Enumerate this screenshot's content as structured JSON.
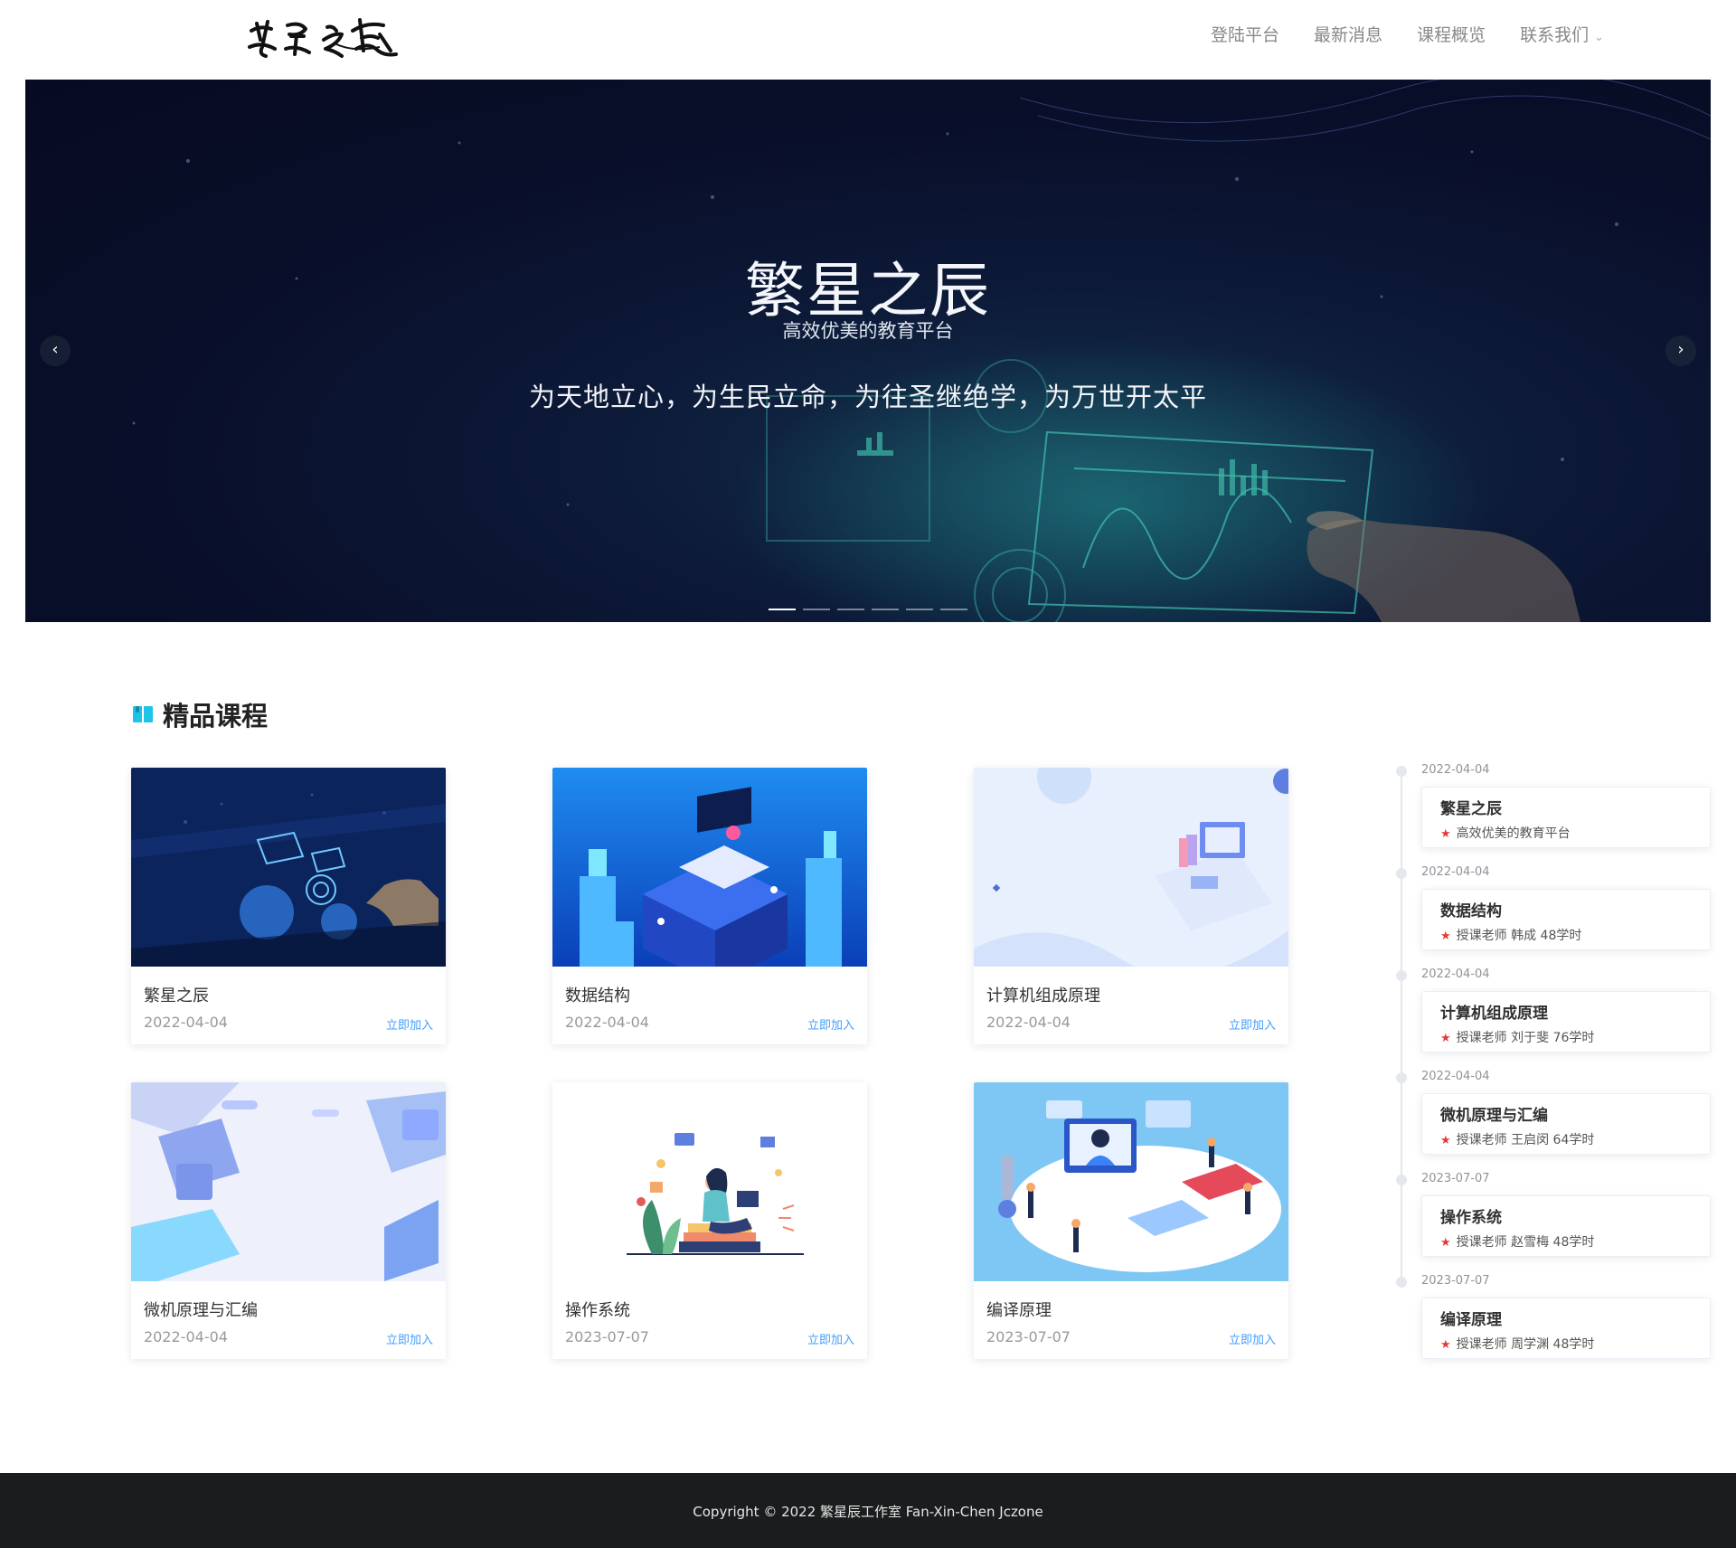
{
  "header": {
    "logo_text": "繁星之辰",
    "nav": [
      {
        "label": "登陆平台"
      },
      {
        "label": "最新消息"
      },
      {
        "label": "课程概览"
      },
      {
        "label": "联系我们",
        "has_dropdown": true
      }
    ]
  },
  "banner": {
    "title": "繁星之辰",
    "subtitle": "高效优美的教育平台",
    "motto": "为天地立心，为生民立命，为往圣继绝学，为万世开太平",
    "prev_icon": "‹",
    "next_icon": "›",
    "slide_count": 6,
    "active_slide": 0
  },
  "section": {
    "title": "精品课程",
    "icon": "book-icon",
    "accent_color": "#1ec4e6"
  },
  "courses": [
    {
      "title": "繁星之辰",
      "date": "2022-04-04",
      "action": "立即加入",
      "image": "dark-tech-hand"
    },
    {
      "title": "数据结构",
      "date": "2022-04-04",
      "action": "立即加入",
      "image": "isometric-blue-laptop"
    },
    {
      "title": "计算机组成原理",
      "date": "2022-04-04",
      "action": "立即加入",
      "image": "light-blue-desk"
    },
    {
      "title": "微机原理与汇编",
      "date": "2022-04-04",
      "action": "立即加入",
      "image": "light-glass-panels"
    },
    {
      "title": "操作系统",
      "date": "2023-07-07",
      "action": "立即加入",
      "image": "woman-on-books"
    },
    {
      "title": "编译原理",
      "date": "2023-07-07",
      "action": "立即加入",
      "image": "isometric-people-tools"
    }
  ],
  "timeline": [
    {
      "date": "2022-04-04",
      "name": "繁星之辰",
      "desc": "高效优美的教育平台"
    },
    {
      "date": "2022-04-04",
      "name": "数据结构",
      "desc": "授课老师 韩成 48学时"
    },
    {
      "date": "2022-04-04",
      "name": "计算机组成原理",
      "desc": "授课老师 刘于斐 76学时"
    },
    {
      "date": "2022-04-04",
      "name": "微机原理与汇编",
      "desc": "授课老师 王启闵 64学时"
    },
    {
      "date": "2023-07-07",
      "name": "操作系统",
      "desc": "授课老师 赵雪梅 48学时"
    },
    {
      "date": "2023-07-07",
      "name": "编译原理",
      "desc": "授课老师 周学渊 48学时"
    }
  ],
  "timeline_star": "★",
  "footer": {
    "copyright": "Copyright © 2022 繁星辰工作室 Fan-Xin-Chen Jczone"
  },
  "colors": {
    "link": "#409eff",
    "footer_bg": "#1b1c1d",
    "star": "#e53935"
  }
}
